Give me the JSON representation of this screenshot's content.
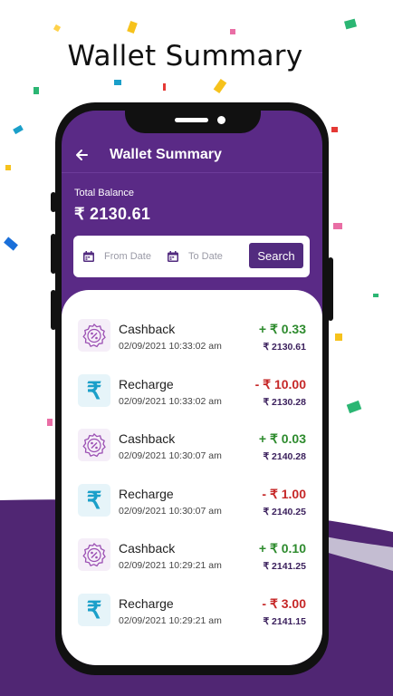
{
  "headline": "Wallet Summary",
  "app": {
    "title": "Wallet Summary",
    "back_icon": "arrow-left-icon"
  },
  "balance": {
    "label": "Total Balance",
    "value": "₹ 2130.61"
  },
  "filter": {
    "from_placeholder": "From Date",
    "to_placeholder": "To Date",
    "search_label": "Search",
    "calendar_icon": "calendar-icon"
  },
  "transactions": [
    {
      "title": "Cashback",
      "date": "02/09/2021 10:33:02 am",
      "amount": "+ ₹ 0.33",
      "balance": "₹ 2130.61",
      "type": "cashback",
      "icon": "percent-badge-icon"
    },
    {
      "title": "Recharge",
      "date": "02/09/2021 10:33:02 am",
      "amount": "- ₹ 10.00",
      "balance": "₹ 2130.28",
      "type": "recharge",
      "icon": "rupee-icon"
    },
    {
      "title": "Cashback",
      "date": "02/09/2021 10:30:07 am",
      "amount": "+ ₹ 0.03",
      "balance": "₹ 2140.28",
      "type": "cashback",
      "icon": "percent-badge-icon"
    },
    {
      "title": "Recharge",
      "date": "02/09/2021 10:30:07 am",
      "amount": "- ₹ 1.00",
      "balance": "₹ 2140.25",
      "type": "recharge",
      "icon": "rupee-icon"
    },
    {
      "title": "Cashback",
      "date": "02/09/2021 10:29:21 am",
      "amount": "+ ₹ 0.10",
      "balance": "₹ 2141.25",
      "type": "cashback",
      "icon": "percent-badge-icon"
    },
    {
      "title": "Recharge",
      "date": "02/09/2021 10:29:21 am",
      "amount": "- ₹ 3.00",
      "balance": "₹ 2141.15",
      "type": "recharge",
      "icon": "rupee-icon"
    }
  ],
  "colors": {
    "primary": "#5a2a86",
    "button": "#522b7f",
    "credit": "#2e8b2e",
    "debit": "#c62828",
    "rupee_icon": "#1a9fc9",
    "percent_icon": "#9b4fb3"
  }
}
